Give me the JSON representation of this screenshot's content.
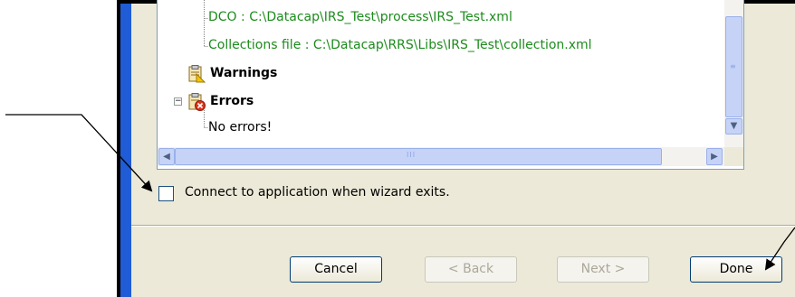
{
  "tree": {
    "dco_line": "DCO : C:\\Datacap\\IRS_Test\\process\\IRS_Test.xml",
    "collections_line": "Collections file : C:\\Datacap\\RRS\\Libs\\IRS_Test\\collection.xml",
    "warnings_label": "Warnings",
    "errors_label": "Errors",
    "no_errors_line": "No errors!",
    "expand_symbol": "−"
  },
  "scrollbars": {
    "up_arrow": "▲",
    "down_arrow": "▼",
    "left_arrow": "◀",
    "right_arrow": "▶",
    "grip": "III"
  },
  "checkbox": {
    "label": "Connect to application when wizard exits.",
    "checked": false
  },
  "buttons": {
    "cancel": "Cancel",
    "back": "< Back",
    "next": "Next >",
    "done": "Done"
  },
  "colors": {
    "accent": "#1f5cd6",
    "tree_text_green": "#1c8c1c",
    "dialog_bg": "#ece9d8"
  }
}
